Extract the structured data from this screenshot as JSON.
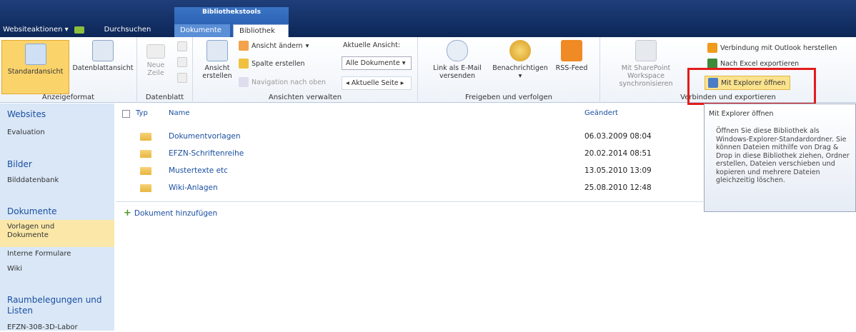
{
  "top": {
    "actions_label": "Websiteaktionen",
    "browse_label": "Durchsuchen",
    "context_group": "Bibliothekstools",
    "tab_documents": "Dokumente",
    "tab_library": "Bibliothek"
  },
  "ribbon": {
    "format": {
      "label": "Anzeigeformat",
      "standard": "Standardansicht",
      "datasheet": "Datenblattansicht"
    },
    "datasheet": {
      "label": "Datenblatt",
      "new_row": "Neue Zeile"
    },
    "views": {
      "label": "Ansichten verwalten",
      "create_view": "Ansicht erstellen",
      "modify_view": "Ansicht ändern",
      "create_column": "Spalte erstellen",
      "nav_up": "Navigation nach oben",
      "current_view_label": "Aktuelle Ansicht:",
      "current_view_value": "Alle Dokumente",
      "current_page": "Aktuelle Seite"
    },
    "share": {
      "label": "Freigeben und verfolgen",
      "email_link": "Link als E-Mail versenden",
      "alerts": "Benachrichtigen",
      "rss": "RSS-Feed"
    },
    "connect": {
      "label": "Verbinden und exportieren",
      "sync": "Mit SharePoint Workspace synchronisieren",
      "outlook": "Verbindung mit Outlook herstellen",
      "excel": "Nach Excel exportieren",
      "explorer": "Mit Explorer öffnen"
    }
  },
  "nav": {
    "websites": "Websites",
    "evaluation": "Evaluation",
    "bilder": "Bilder",
    "bilddatenbank": "Bilddatenbank",
    "dokumente": "Dokumente",
    "vorlagen": "Vorlagen und Dokumente",
    "interne": "Interne Formulare",
    "wiki": "Wiki",
    "raum": "Raumbelegungen und Listen",
    "efzn": "EFZN-308-3D-Labor"
  },
  "list": {
    "col_type": "Typ",
    "col_name": "Name",
    "col_modified": "Geändert",
    "rows": [
      {
        "name": "Dokumentvorlagen",
        "modified": "06.03.2009 08:04"
      },
      {
        "name": "EFZN-Schriftenreihe",
        "modified": "20.02.2014 08:51"
      },
      {
        "name": "Mustertexte etc",
        "modified": "13.05.2010 13:09"
      },
      {
        "name": "Wiki-Anlagen",
        "modified": "25.08.2010 12:48"
      }
    ],
    "add_document": "Dokument hinzufügen"
  },
  "tooltip": {
    "title": "Mit Explorer öffnen",
    "body": "Öffnen Sie diese Bibliothek als Windows-Explorer-Standardordner. Sie können Dateien mithilfe von Drag & Drop in diese Bibliothek ziehen, Ordner erstellen, Dateien verschieben und kopieren und mehrere Dateien gleichzeitig löschen."
  }
}
